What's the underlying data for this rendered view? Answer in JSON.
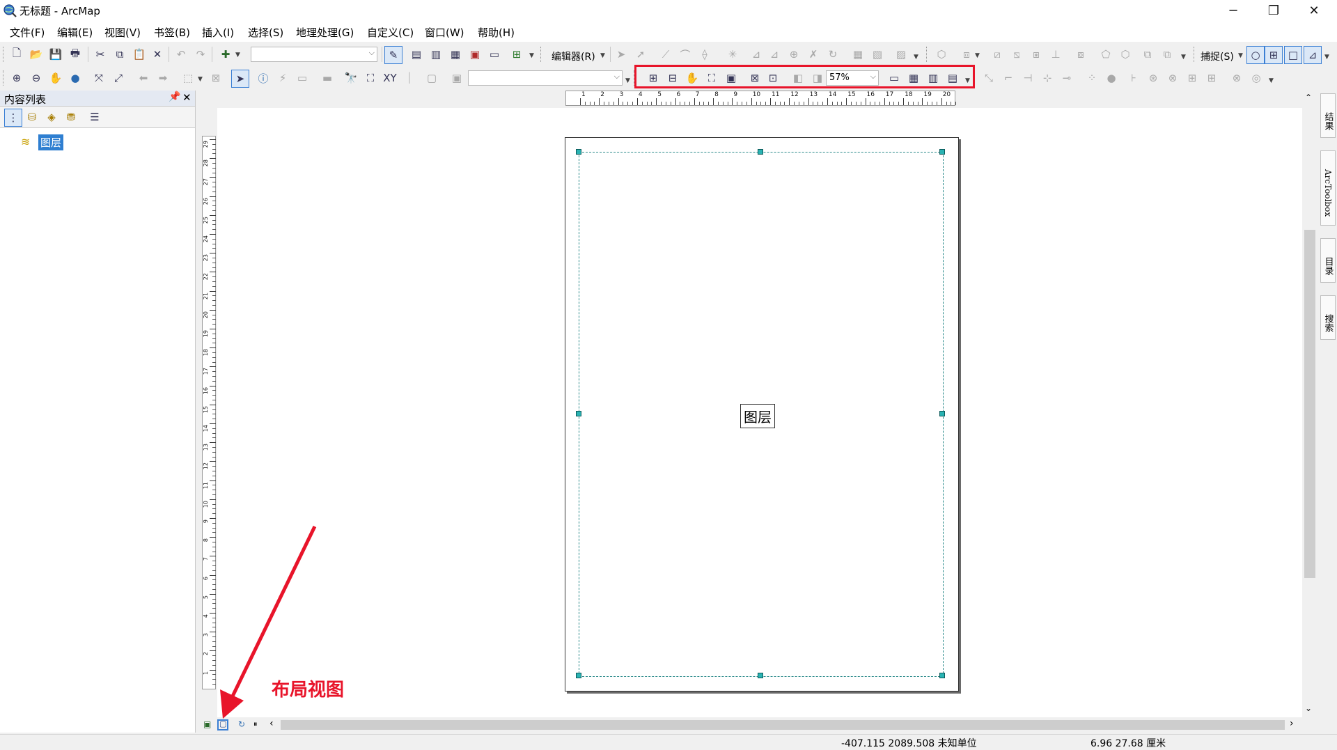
{
  "window": {
    "title": "无标题 - ArcMap",
    "controls": [
      "minimize",
      "restore",
      "close"
    ]
  },
  "menu": [
    "文件(F)",
    "编辑(E)",
    "视图(V)",
    "书签(B)",
    "插入(I)",
    "选择(S)",
    "地理处理(G)",
    "自定义(C)",
    "窗口(W)",
    "帮助(H)"
  ],
  "toolbar1": {
    "editor_label": "编辑器(R)",
    "snapping_label": "捕捉(S)",
    "scale_value": ""
  },
  "toolbar2": {
    "layout_zoom_value": "57%",
    "target_value": ""
  },
  "toc": {
    "title": "内容列表",
    "layer_node": "图层"
  },
  "layout": {
    "frame_label": "图层",
    "hruler_ticks": [
      "1",
      "2",
      "3",
      "4",
      "5",
      "6",
      "7",
      "8",
      "9",
      "10",
      "11",
      "12",
      "13",
      "14",
      "15",
      "16",
      "17",
      "18",
      "19",
      "20"
    ],
    "vruler_ticks": [
      "29",
      "28",
      "27",
      "26",
      "25",
      "24",
      "23",
      "22",
      "21",
      "20",
      "19",
      "18",
      "17",
      "16",
      "15",
      "14",
      "13",
      "12",
      "11",
      "10",
      "9",
      "8",
      "7",
      "6",
      "5",
      "4",
      "3",
      "2",
      "1"
    ]
  },
  "side_tabs": [
    "结果",
    "ArcToolbox",
    "目录",
    "搜索"
  ],
  "status": {
    "coords": "-407.115  2089.508 未知单位",
    "page_coords": "6.96  27.68 厘米"
  },
  "annotation": {
    "label": "布局视图",
    "color": "#e8142a"
  }
}
